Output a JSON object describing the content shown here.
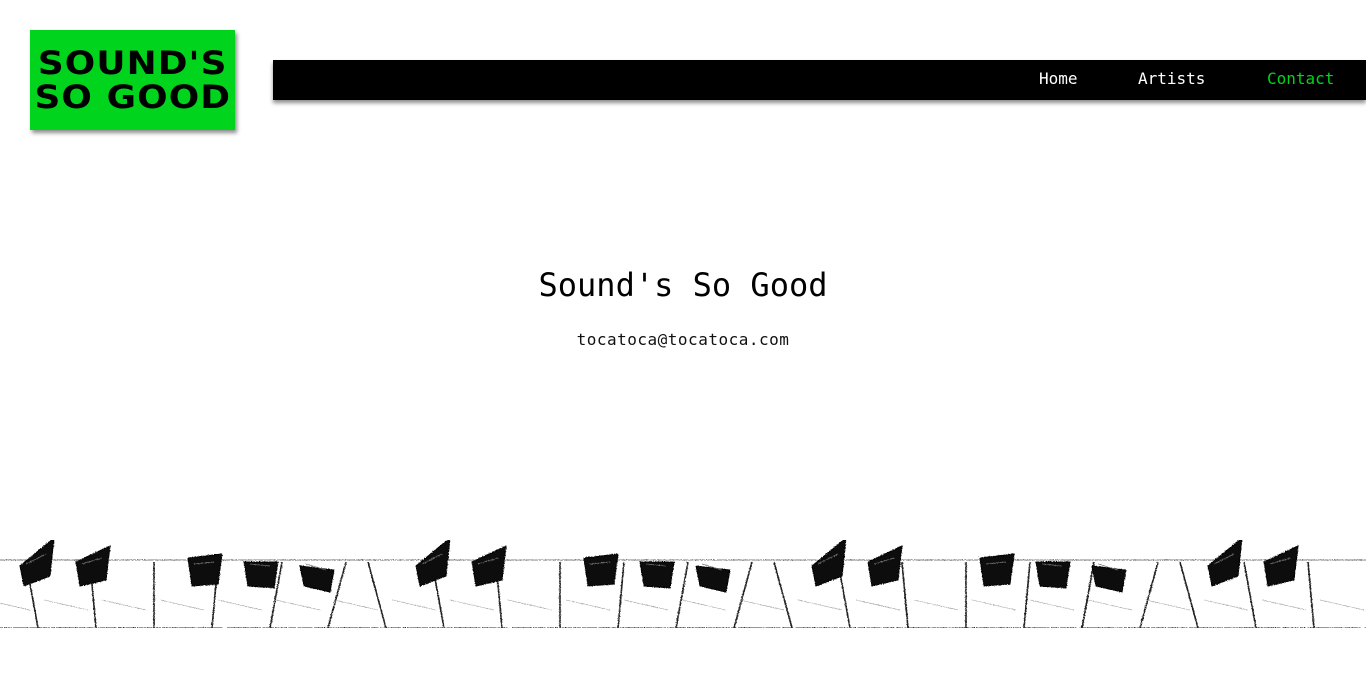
{
  "logo": {
    "line1": "SOUND'S",
    "line2": "SO GOOD"
  },
  "nav": {
    "items": [
      {
        "label": "Home",
        "active": false
      },
      {
        "label": "Artists",
        "active": false
      },
      {
        "label": "Contact",
        "active": true
      }
    ]
  },
  "main": {
    "title": "Sound's So Good",
    "email": "tocatoca@tocatoca.com"
  },
  "colors": {
    "accent": "#00d41c",
    "nav_background": "#000000",
    "background": "#ffffff"
  },
  "decoration": {
    "footer_image": "piano-keys-sketch"
  }
}
